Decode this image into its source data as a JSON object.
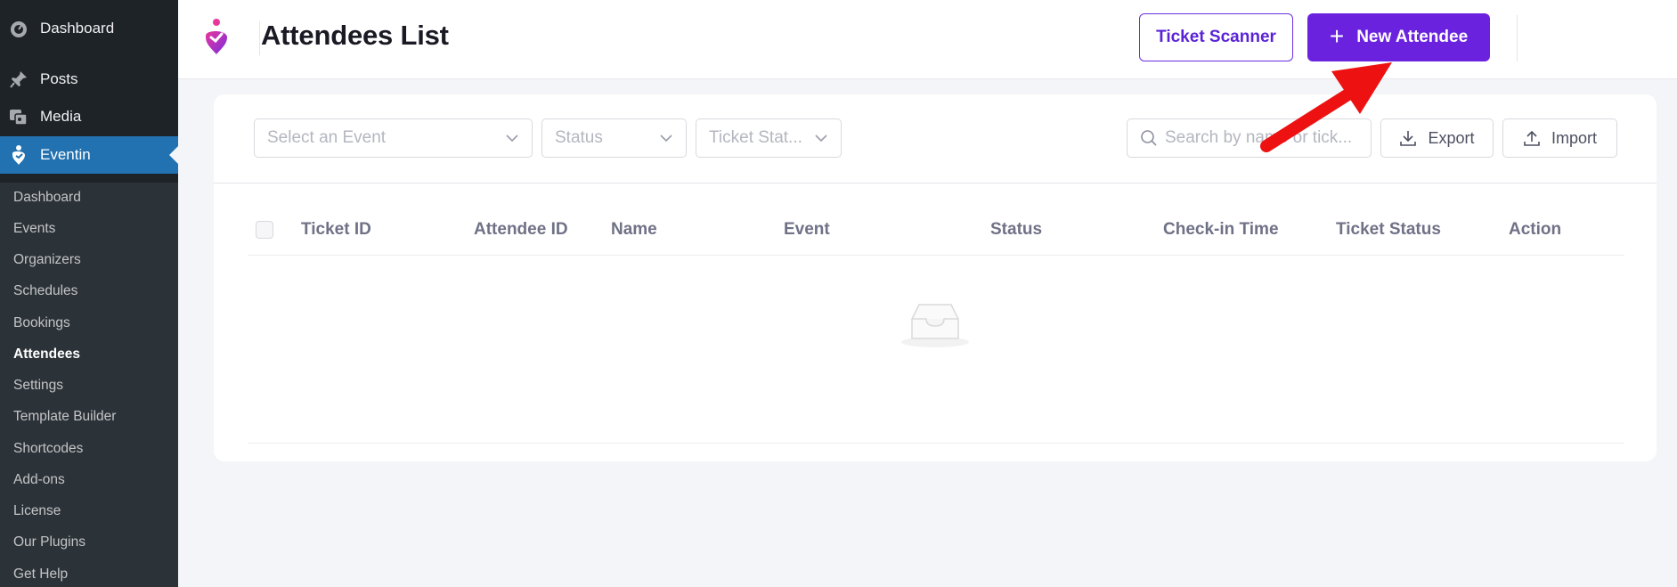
{
  "sidebar": {
    "top_items": [
      {
        "label": "Dashboard",
        "icon": "dashboard-icon"
      },
      {
        "label": "Posts",
        "icon": "pin-icon"
      },
      {
        "label": "Media",
        "icon": "media-icon"
      },
      {
        "label": "Eventin",
        "icon": "eventin-icon"
      }
    ],
    "sub_items": [
      {
        "label": "Dashboard"
      },
      {
        "label": "Events"
      },
      {
        "label": "Organizers"
      },
      {
        "label": "Schedules"
      },
      {
        "label": "Bookings"
      },
      {
        "label": "Attendees"
      },
      {
        "label": "Settings"
      },
      {
        "label": "Template Builder"
      },
      {
        "label": "Shortcodes"
      },
      {
        "label": "Add-ons"
      },
      {
        "label": "License"
      },
      {
        "label": "Our Plugins"
      },
      {
        "label": "Get Help"
      }
    ]
  },
  "header": {
    "title": "Attendees List",
    "scanner_label": "Ticket Scanner",
    "new_label": "New Attendee"
  },
  "filters": {
    "event_placeholder": "Select an Event",
    "status_placeholder": "Status",
    "ticket_status_placeholder": "Ticket Stat...",
    "search_placeholder": "Search by name or tick...",
    "export_label": "Export",
    "import_label": "Import"
  },
  "table": {
    "columns": [
      "Ticket ID",
      "Attendee ID",
      "Name",
      "Event",
      "Status",
      "Check-in Time",
      "Ticket Status",
      "Action"
    ]
  },
  "colors": {
    "accent": "#6a22df",
    "sidebar_bg": "#1d2327",
    "active_menu": "#2271b1"
  }
}
